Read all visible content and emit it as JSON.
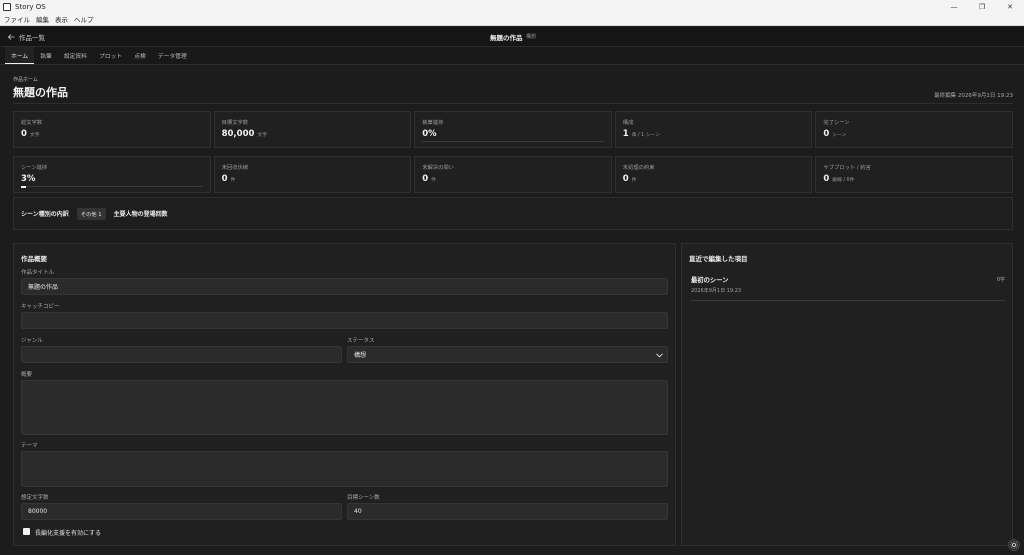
{
  "window": {
    "title": "Story OS",
    "controls": [
      "—",
      "❐",
      "✕"
    ]
  },
  "menu": [
    "ファイル",
    "編集",
    "表示",
    "ヘルプ"
  ],
  "header": {
    "back_label": "作品一覧",
    "work_title": "無題の作品",
    "work_status": "構想"
  },
  "tabs": [
    {
      "label": "ホーム",
      "active": true
    },
    {
      "label": "執筆"
    },
    {
      "label": "設定資料"
    },
    {
      "label": "プロット"
    },
    {
      "label": "点検"
    },
    {
      "label": "データ管理"
    }
  ],
  "page": {
    "kicker": "作品ホーム",
    "title": "無題の作品",
    "last_edited": "最終編集 2026年9月1日 19:23"
  },
  "stats_row1": [
    {
      "label": "総文字数",
      "value": "0",
      "unit": "文字"
    },
    {
      "label": "目標文字数",
      "value": "80,000",
      "unit": "文字"
    },
    {
      "label": "執筆進捗",
      "value": "0%",
      "unit": "",
      "progress": 0
    },
    {
      "label": "構成",
      "value": "1",
      "unit": "章 / 1 シーン"
    },
    {
      "label": "完了シーン",
      "value": "0",
      "unit": "シーン"
    }
  ],
  "stats_row2": [
    {
      "label": "シーン進捗",
      "value": "3%",
      "unit": "",
      "progress": 0.03
    },
    {
      "label": "未回収伏線",
      "value": "0",
      "unit": "件"
    },
    {
      "label": "未解決の問い",
      "value": "0",
      "unit": "件"
    },
    {
      "label": "未処理の約束",
      "value": "0",
      "unit": "件"
    },
    {
      "label": "サブプロット / 約言",
      "value": "0",
      "unit": "劇線 / 0件"
    }
  ],
  "breakdown": {
    "label": "シーン種別の内訳",
    "chip": "その他 1",
    "characters_label": "主要人物の登場回数"
  },
  "overview": {
    "title": "作品概要",
    "title_label": "作品タイトル",
    "title_value": "無題の作品",
    "catch_label": "キャッチコピー",
    "catch_value": "",
    "genre_label": "ジャンル",
    "genre_value": "",
    "status_label": "ステータス",
    "status_value": "構想",
    "summary_label": "概要",
    "summary_value": "",
    "theme_label": "テーマ",
    "theme_value": "",
    "target_chars_label": "想定文字数",
    "target_chars_value": "80000",
    "target_scenes_label": "目標シーン数",
    "target_scenes_value": "40",
    "long_mode_label": "長編化支援を有効にする"
  },
  "recent": {
    "title": "直近で編集した項目",
    "items": [
      {
        "title": "最初のシーン",
        "date": "2026年9月1日 19:23",
        "count": "0字"
      }
    ]
  },
  "icons": {
    "back": "arrow-left-icon",
    "theme": "sun-icon",
    "select": "chevron-down-icon"
  }
}
